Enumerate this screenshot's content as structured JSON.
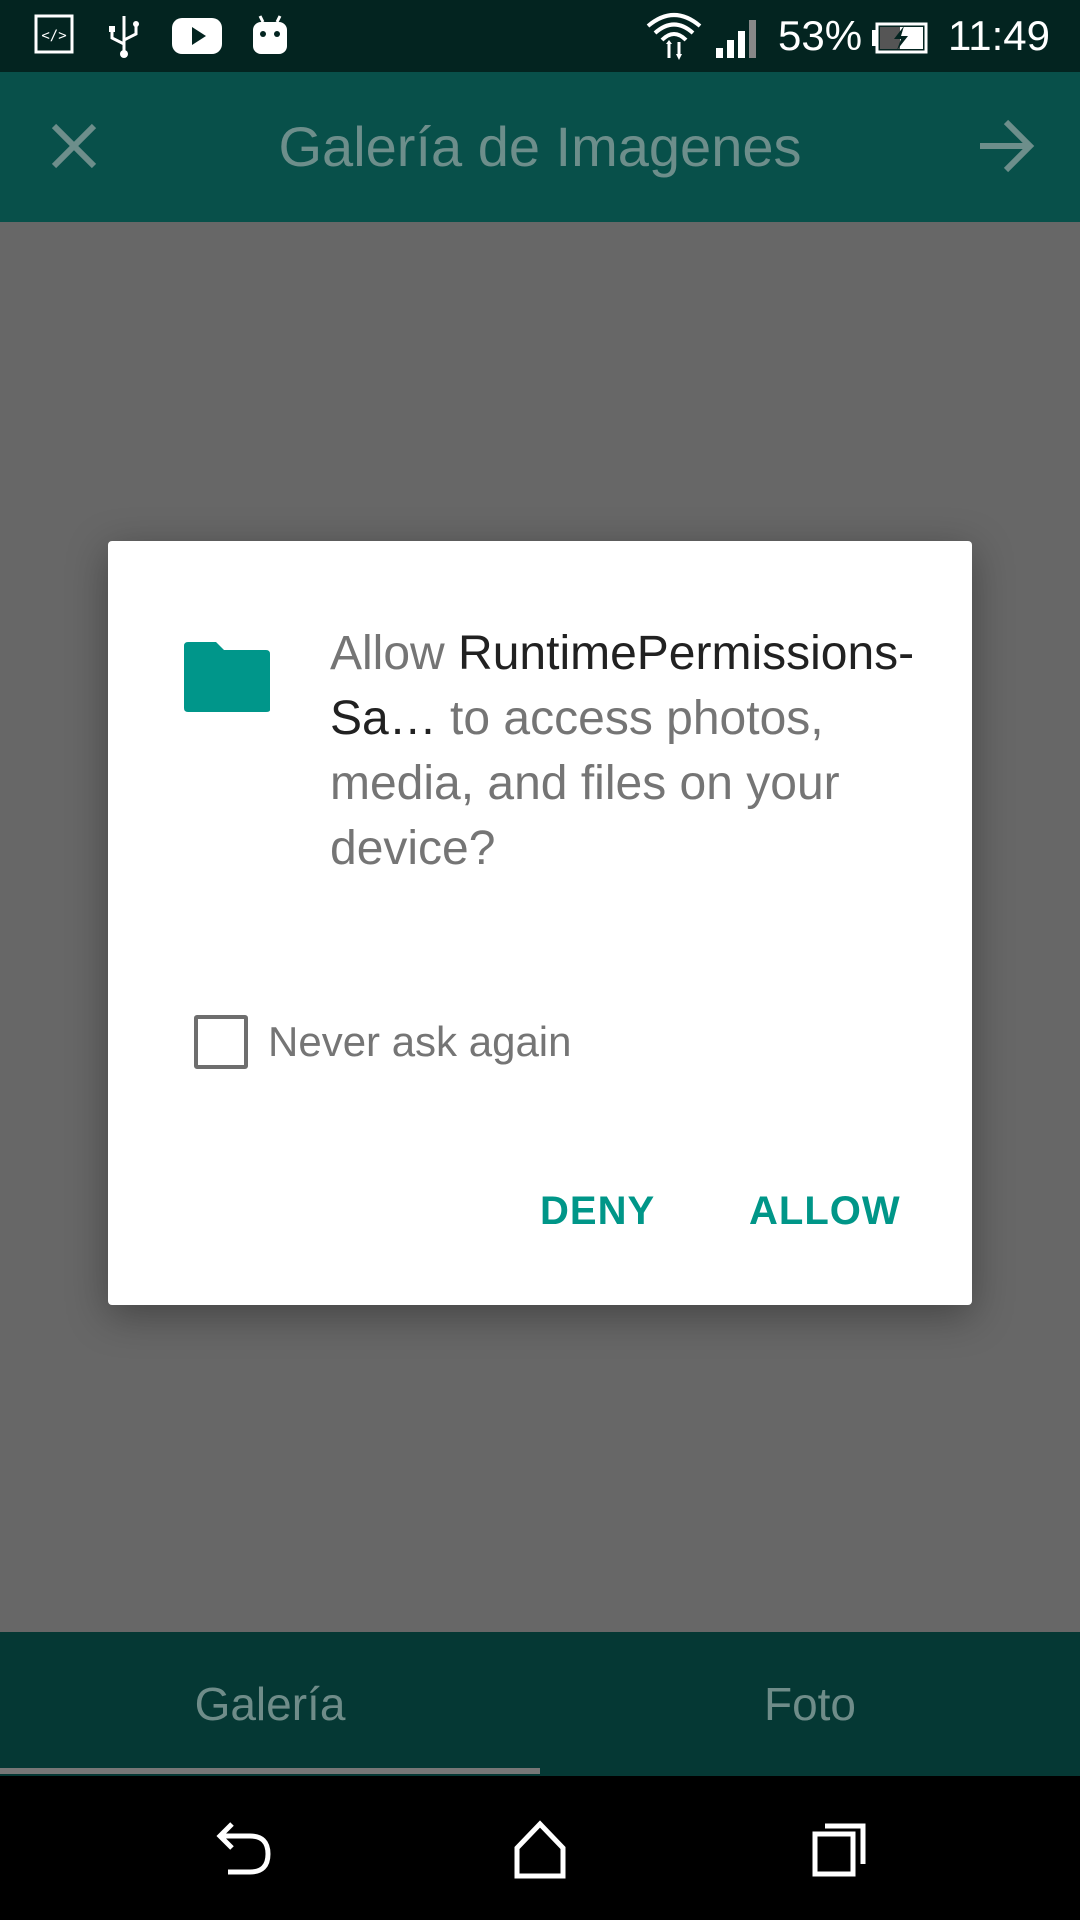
{
  "status_bar": {
    "icons": [
      "code-icon",
      "usb-icon",
      "youtube-icon",
      "android-icon",
      "wifi-icon",
      "signal-icon",
      "battery-charging-icon"
    ],
    "battery": "53%",
    "time": "11:49"
  },
  "app_bar": {
    "title": "Galería de Imagenes",
    "close_icon": "close-icon",
    "next_icon": "arrow-forward-icon"
  },
  "dialog": {
    "icon": "folder-icon",
    "message_prefix": "Allow ",
    "app_name": "RuntimePermissions-Sa…",
    "message_suffix": " to access photos, media, and files on your device?",
    "checkbox_label": "Never ask again",
    "checkbox_checked": false,
    "deny_label": "DENY",
    "allow_label": "ALLOW"
  },
  "tabs": {
    "items": [
      {
        "label": "Galería",
        "selected": true
      },
      {
        "label": "Foto",
        "selected": false
      }
    ]
  },
  "nav_bar": {
    "icons": [
      "back-icon",
      "home-icon",
      "recents-icon"
    ]
  },
  "colors": {
    "primary": "#08504a",
    "accent": "#009688",
    "status_bar": "#032420",
    "scrim": "#676767"
  }
}
